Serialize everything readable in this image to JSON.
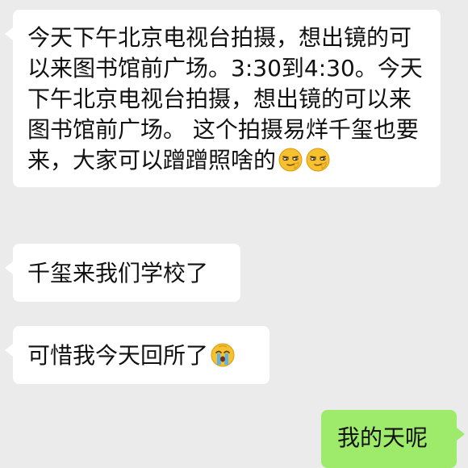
{
  "messages": [
    {
      "side": "incoming",
      "text": "今天下午北京电视台拍摄，想出镜的可以来图书馆前广场。3:30到4:30。今天下午北京电视台拍摄，想出镜的可以来图书馆前广场。 这个拍摄易烊千玺也要来，大家可以蹭蹭照啥的",
      "trailing_icons": [
        "smug-face-icon",
        "smug-face-icon"
      ]
    },
    {
      "side": "incoming",
      "text": "千玺来我们学校了"
    },
    {
      "side": "incoming",
      "text": "可惜我今天回所了",
      "trailing_icons": [
        "crying-face-icon"
      ]
    },
    {
      "side": "outgoing",
      "text": "我的天呢"
    }
  ],
  "colors": {
    "background": "#ebebeb",
    "incoming_bubble": "#ffffff",
    "outgoing_bubble": "#9eea6a"
  }
}
